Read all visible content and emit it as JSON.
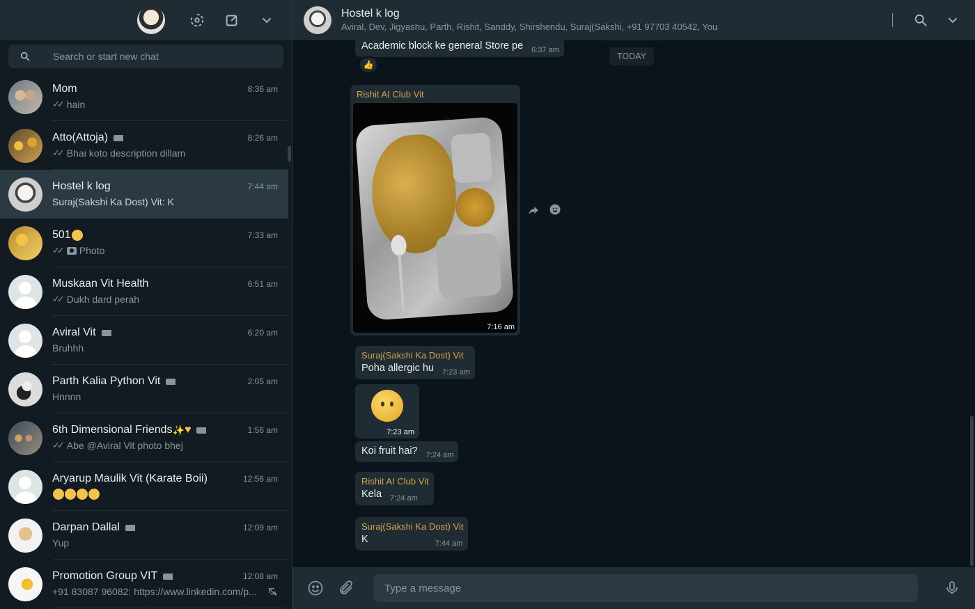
{
  "sidebar": {
    "search_placeholder": "Search or start new chat",
    "chats": [
      {
        "name": "Mom",
        "time": "8:36 am",
        "message": "hain",
        "ticks": true
      },
      {
        "name": "Atto(Attoja)",
        "time": "8:26 am",
        "message": "Bhai koto description dillam",
        "ticks": true,
        "label": true
      },
      {
        "name": "Hostel k log",
        "time": "7:44 am",
        "message": "Suraj(Sakshi Ka Dost) Vit: K",
        "active": true
      },
      {
        "name": "501",
        "time": "7:33 am",
        "message": "Photo",
        "ticks": true,
        "photo": true
      },
      {
        "name": "Muskaan Vit Health",
        "time": "6:51 am",
        "message": "Dukh dard perah",
        "ticks": true
      },
      {
        "name": "Aviral Vit",
        "time": "6:20 am",
        "message": "Bruhhh",
        "label": true
      },
      {
        "name": "Parth Kalia Python Vit",
        "time": "2:05 am",
        "message": "Hnnnn",
        "label": true
      },
      {
        "name": "6th Dimensional Friends",
        "time": "1:56 am",
        "message": "Abe @Aviral Vit  photo bhej",
        "ticks": true,
        "label": true
      },
      {
        "name": "Aryarup Maulik Vit (Karate Boii)",
        "time": "12:56 am",
        "message": ""
      },
      {
        "name": "Darpan Dallal",
        "time": "12:09 am",
        "message": "Yup",
        "label": true
      },
      {
        "name": "Promotion Group VIT",
        "time": "12:08 am",
        "message": "+91 83087 96082: https://www.linkedin.com/p...",
        "label": true,
        "muted": true
      }
    ]
  },
  "header": {
    "title": "Hostel k log",
    "members": "Aviral, Dev, Jigyashu, Parth, Rishit, Sanddy, Shirshendu, Suraj(Sakshi, +91 97703 40542, You"
  },
  "messages": {
    "first": {
      "text": "Academic block ke general Store pe",
      "time": "6:37 am"
    },
    "today": "TODAY",
    "image_msg": {
      "sender": "Rishit AI Club Vit",
      "time": "7:16 am"
    },
    "m1": {
      "sender": "Suraj(Sakshi Ka Dost) Vit",
      "text": "Poha allergic hu",
      "time": "7:23 am"
    },
    "m2": {
      "time": "7:23 am"
    },
    "m3": {
      "text": "Koi fruit hai?",
      "time": "7:24 am"
    },
    "m4": {
      "sender": "Rishit AI Club Vit",
      "text": "Kela",
      "time": "7:24 am"
    },
    "m5": {
      "sender": "Suraj(Sakshi Ka Dost) Vit",
      "text": "K",
      "time": "7:44 am"
    }
  },
  "composer": {
    "placeholder": "Type a message"
  },
  "colors": {
    "sender_name": "#d4a34a",
    "bubble": "#202c33",
    "background": "#0b141a"
  }
}
